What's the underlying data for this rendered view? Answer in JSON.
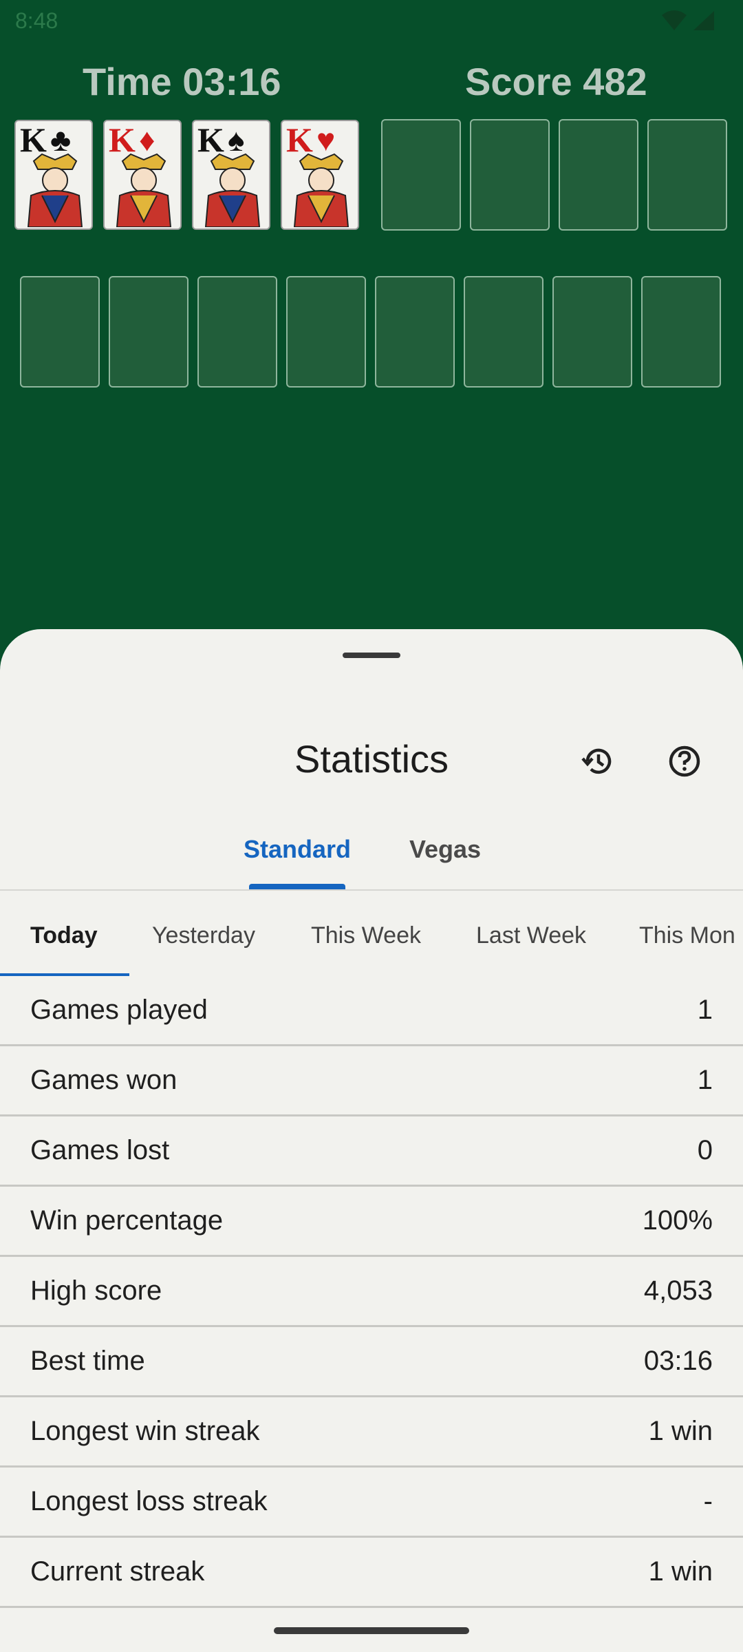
{
  "status_bar": {
    "time": "8:48",
    "icons": [
      "wifi-icon",
      "signal-icon"
    ]
  },
  "header": {
    "time": "Time 03:16",
    "score": "Score 482"
  },
  "foundation_cards": [
    {
      "rank": "K",
      "suit": "♣",
      "color": "black"
    },
    {
      "rank": "K",
      "suit": "♦",
      "color": "red"
    },
    {
      "rank": "K",
      "suit": "♠",
      "color": "black"
    },
    {
      "rank": "K",
      "suit": "♥",
      "color": "red"
    }
  ],
  "sheet": {
    "title": "Statistics",
    "icons": [
      "history-icon",
      "help-icon"
    ],
    "mode_tabs": [
      "Standard",
      "Vegas"
    ],
    "active_mode": "Standard",
    "period_tabs": [
      "Today",
      "Yesterday",
      "This Week",
      "Last Week",
      "This Mon"
    ],
    "active_period": "Today",
    "rows": [
      {
        "label": "Games played",
        "value": "1"
      },
      {
        "label": "Games won",
        "value": "1"
      },
      {
        "label": "Games lost",
        "value": "0"
      },
      {
        "label": "Win percentage",
        "value": "100%"
      },
      {
        "label": "High score",
        "value": "4,053"
      },
      {
        "label": "Best time",
        "value": "03:16"
      },
      {
        "label": "Longest win streak",
        "value": "1 win"
      },
      {
        "label": "Longest loss streak",
        "value": "-"
      },
      {
        "label": "Current streak",
        "value": "1 win"
      }
    ]
  },
  "colors": {
    "felt": "#064f2a",
    "accent": "#1565c0",
    "sheet_bg": "#f2f2ee"
  }
}
